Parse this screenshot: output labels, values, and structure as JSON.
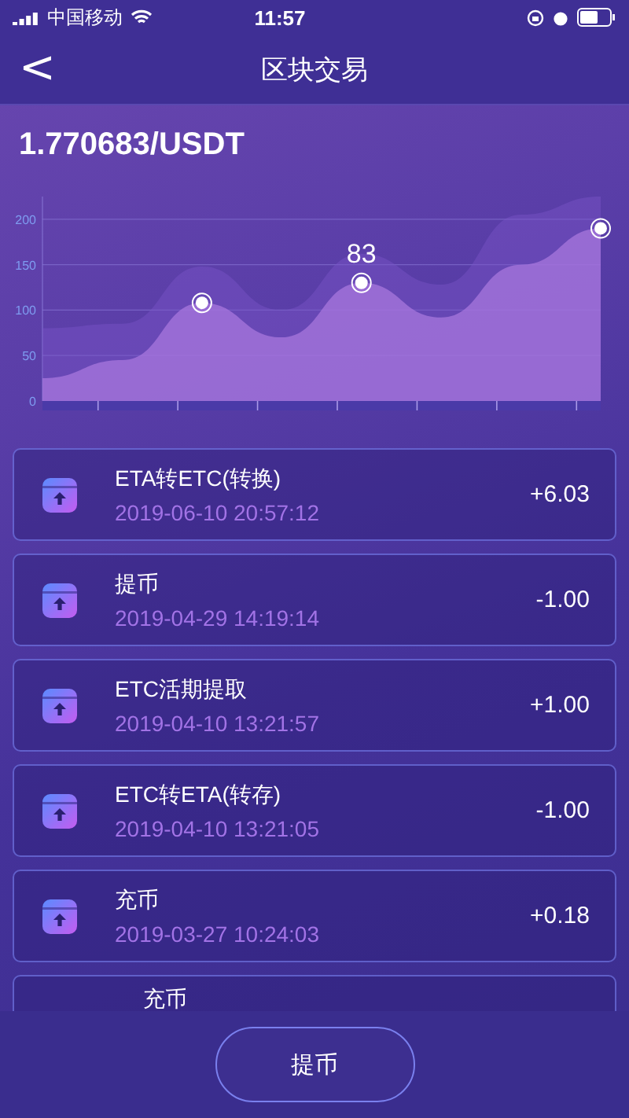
{
  "status_bar": {
    "carrier": "中国移动",
    "time": "11:57"
  },
  "nav": {
    "title": "区块交易",
    "back": "<"
  },
  "price": "1.770683/USDT",
  "chart_data": {
    "type": "area",
    "ylim": [
      0,
      225
    ],
    "yticks": [
      0,
      50,
      100,
      150,
      200
    ],
    "grid": true,
    "series": [
      {
        "color": "#7a55c8",
        "values": [
          80,
          85,
          148,
          100,
          162,
          128,
          205,
          225
        ]
      },
      {
        "color": "#a877dd",
        "values": [
          25,
          45,
          108,
          70,
          130,
          92,
          150,
          190
        ]
      }
    ]
  },
  "chart_label": "83",
  "records": [
    {
      "title": "ETA转ETC(转换)",
      "time": "2019-06-10 20:57:12",
      "amount": "+6.03"
    },
    {
      "title": "提币",
      "time": "2019-04-29 14:19:14",
      "amount": "-1.00"
    },
    {
      "title": "ETC活期提取",
      "time": "2019-04-10 13:21:57",
      "amount": "+1.00"
    },
    {
      "title": "ETC转ETA(转存)",
      "time": "2019-04-10 13:21:05",
      "amount": "-1.00"
    },
    {
      "title": "充币",
      "time": "2019-03-27 10:24:03",
      "amount": "+0.18"
    },
    {
      "title": "充币"
    }
  ],
  "action_button": "提币"
}
